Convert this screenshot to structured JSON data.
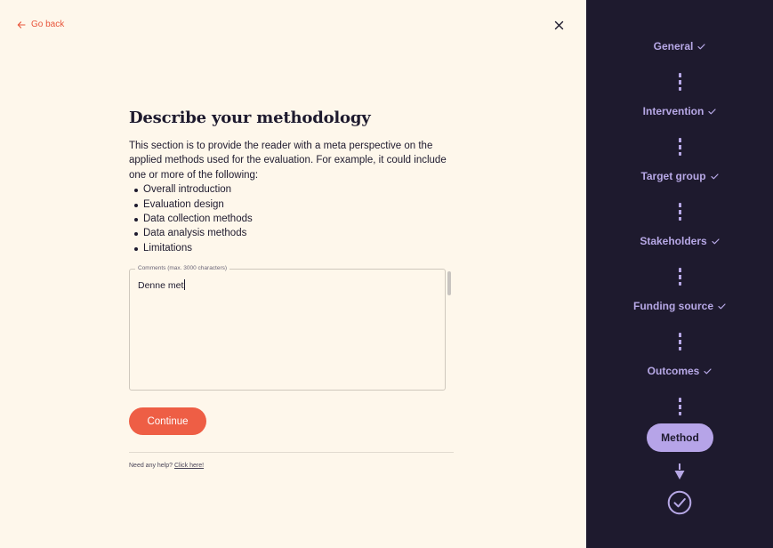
{
  "nav": {
    "go_back_label": "Go back"
  },
  "main": {
    "title": "Describe your methodology",
    "description": "This section is to provide the reader with a meta perspective on the applied methods used for the evaluation. For example, it could include one or more of the following:",
    "bullets": [
      "Overall introduction",
      "Evaluation design",
      "Data collection methods",
      "Data analysis methods",
      "Limitations"
    ],
    "comments": {
      "label": "Comments (max. 3000 characters)",
      "value": "Denne met"
    },
    "continue_label": "Continue",
    "help_text": "Need any help?",
    "help_link": "Click here!"
  },
  "sidebar": {
    "steps": [
      {
        "label": "General"
      },
      {
        "label": "Intervention"
      },
      {
        "label": "Target group"
      },
      {
        "label": "Stakeholders"
      },
      {
        "label": "Funding source"
      },
      {
        "label": "Outcomes"
      }
    ],
    "active_step": "Method"
  },
  "colors": {
    "accent": "#ee5e45",
    "sidebar_bg": "#1e1a2e",
    "sidebar_text": "#b7a8e6",
    "active_pill": "#b6a4e8",
    "page_bg": "#fef7eb"
  }
}
